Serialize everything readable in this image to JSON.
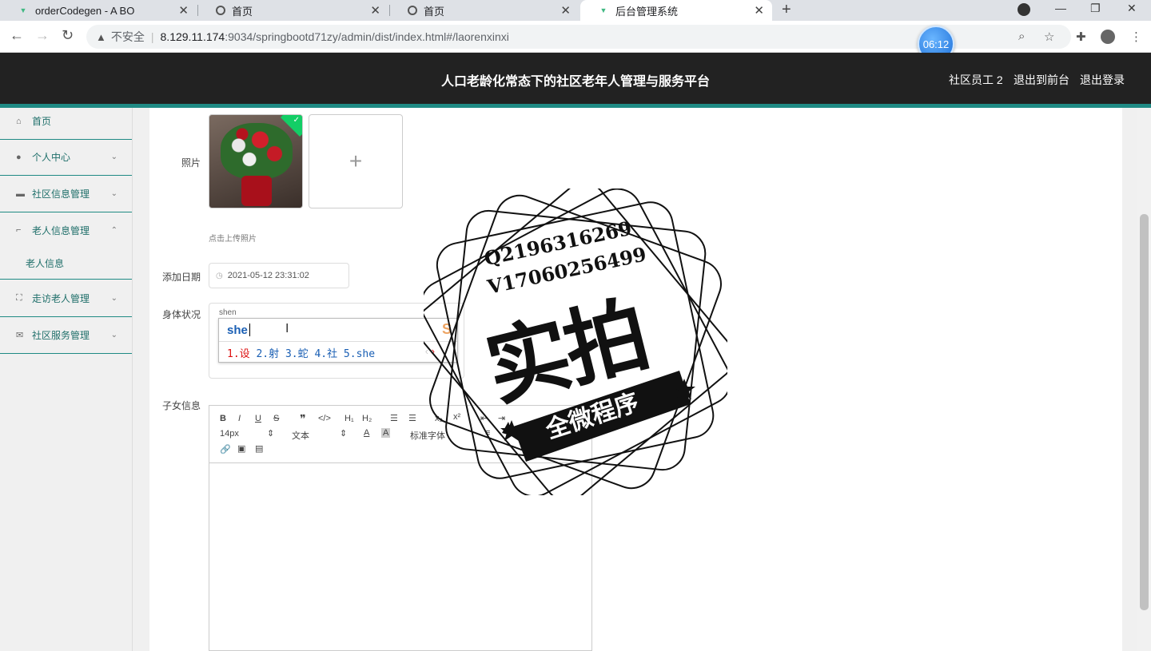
{
  "browser": {
    "tabs": [
      {
        "title": "orderCodegen - A BO",
        "favicon": "vue-icon",
        "active": false
      },
      {
        "title": "首页",
        "favicon": "globe-icon",
        "active": false
      },
      {
        "title": "首页",
        "favicon": "globe-icon",
        "active": false
      },
      {
        "title": "后台管理系统",
        "favicon": "vue-icon",
        "active": true
      }
    ],
    "insecure_label": "不安全",
    "url_host": "8.129.11.174",
    "url_rest": ":9034/springbootd71zy/admin/dist/index.html#/laorenxinxi",
    "timer": "06:12"
  },
  "header": {
    "title": "人口老龄化常态下的社区老年人管理与服务平台",
    "user": "社区员工 2",
    "front_link": "退出到前台",
    "logout_link": "退出登录"
  },
  "sidebar": {
    "items": [
      {
        "label": "首页",
        "icon": "home-icon"
      },
      {
        "label": "个人中心",
        "icon": "user-icon"
      },
      {
        "label": "社区信息管理",
        "icon": "ticket-icon"
      },
      {
        "label": "老人信息管理",
        "icon": "crop-icon"
      },
      {
        "label": "走访老人管理",
        "icon": "fullscreen-icon"
      },
      {
        "label": "社区服务管理",
        "icon": "message-icon"
      }
    ],
    "subitem": "老人信息"
  },
  "form": {
    "photo_label": "照片",
    "upload_hint": "点击上传照片",
    "date_label": "添加日期",
    "date_value": "2021-05-12 23:31:02",
    "health_label": "身体状况",
    "health_typed": "shen",
    "children_label": "子女信息"
  },
  "ime": {
    "composition": "she",
    "candidates_first": "1.设",
    "candidates_rest": " 2.射  3.蛇  4.社  5.she"
  },
  "editor": {
    "font_size": "14px",
    "paragraph": "文本",
    "font_family": "标准字体"
  },
  "watermark": {
    "line1": "Q2196316269",
    "line2": "V17060256499",
    "big": "实拍",
    "banner": "全微程序"
  }
}
